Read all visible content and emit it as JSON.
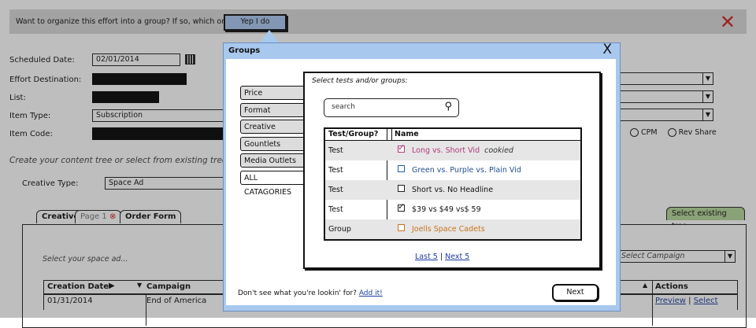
{
  "topbar": {
    "question": "Want to organize this effort into a group? If so, which ones?",
    "yep_button": "Yep I do"
  },
  "form": {
    "scheduled_date_label": "Scheduled Date:",
    "scheduled_date_value": "02/01/2014",
    "effort_destination_label": "Effort Destination:",
    "list_label": "List:",
    "item_type_label": "Item Type:",
    "item_type_value": "Subscription",
    "item_code_label": "Item Code:",
    "pricing_options": [
      "CPM",
      "Rev Share"
    ],
    "content_tree_hint": "Create your content tree or select from existing trees...",
    "creative_type_label": "Creative Type:",
    "creative_type_value": "Space Ad"
  },
  "tabs": {
    "creative": "Creative",
    "page1": "Page 1",
    "order_form": "Order Form",
    "select_existing": "Select existing tree"
  },
  "space_ad": {
    "hint": "Select your space ad...",
    "select_campaign": "Select Campaign",
    "columns": [
      "Creation Date",
      "Campaign",
      "Actions"
    ],
    "row": {
      "date": "01/31/2014",
      "campaign": "End of America",
      "preview": "Preview",
      "select": "Select",
      "sep": "|"
    }
  },
  "modal": {
    "title": "Groups",
    "close": "X",
    "categories": [
      "Price",
      "Format",
      "Creative",
      "Gountlets",
      "Media Outlets",
      "ALL CATAGORIES"
    ],
    "instruction": "Select tests and/or groups:",
    "search_placeholder": "search",
    "columns": {
      "type": "Test/Group?",
      "name": "Name"
    },
    "rows": [
      {
        "type": "Test",
        "name": "Long vs. Short Vid",
        "note": "cookied",
        "checked": true,
        "color": "#b03a7a",
        "box": "#b03a7a"
      },
      {
        "type": "Test",
        "name": "Green vs. Purple vs. Plain Vid",
        "note": "",
        "checked": false,
        "color": "#1f4f8f",
        "box": "#1f5fa8"
      },
      {
        "type": "Test",
        "name": "Short vs. No Headline",
        "note": "",
        "checked": false,
        "color": "#111111",
        "box": "#222222"
      },
      {
        "type": "Test",
        "name": "$39 vs $49 vs$ 59",
        "note": "",
        "checked": true,
        "color": "#111111",
        "box": "#222222"
      },
      {
        "type": "Group",
        "name": "Joells Space Cadets",
        "note": "",
        "checked": false,
        "color": "#c8741e",
        "box": "#c8741e"
      }
    ],
    "pager": {
      "last": "Last 5",
      "sep": "|",
      "next": "Next 5"
    },
    "footer_text": "Don't see what you're lookin' for?",
    "add_it": "Add it!",
    "next_button": "Next"
  }
}
